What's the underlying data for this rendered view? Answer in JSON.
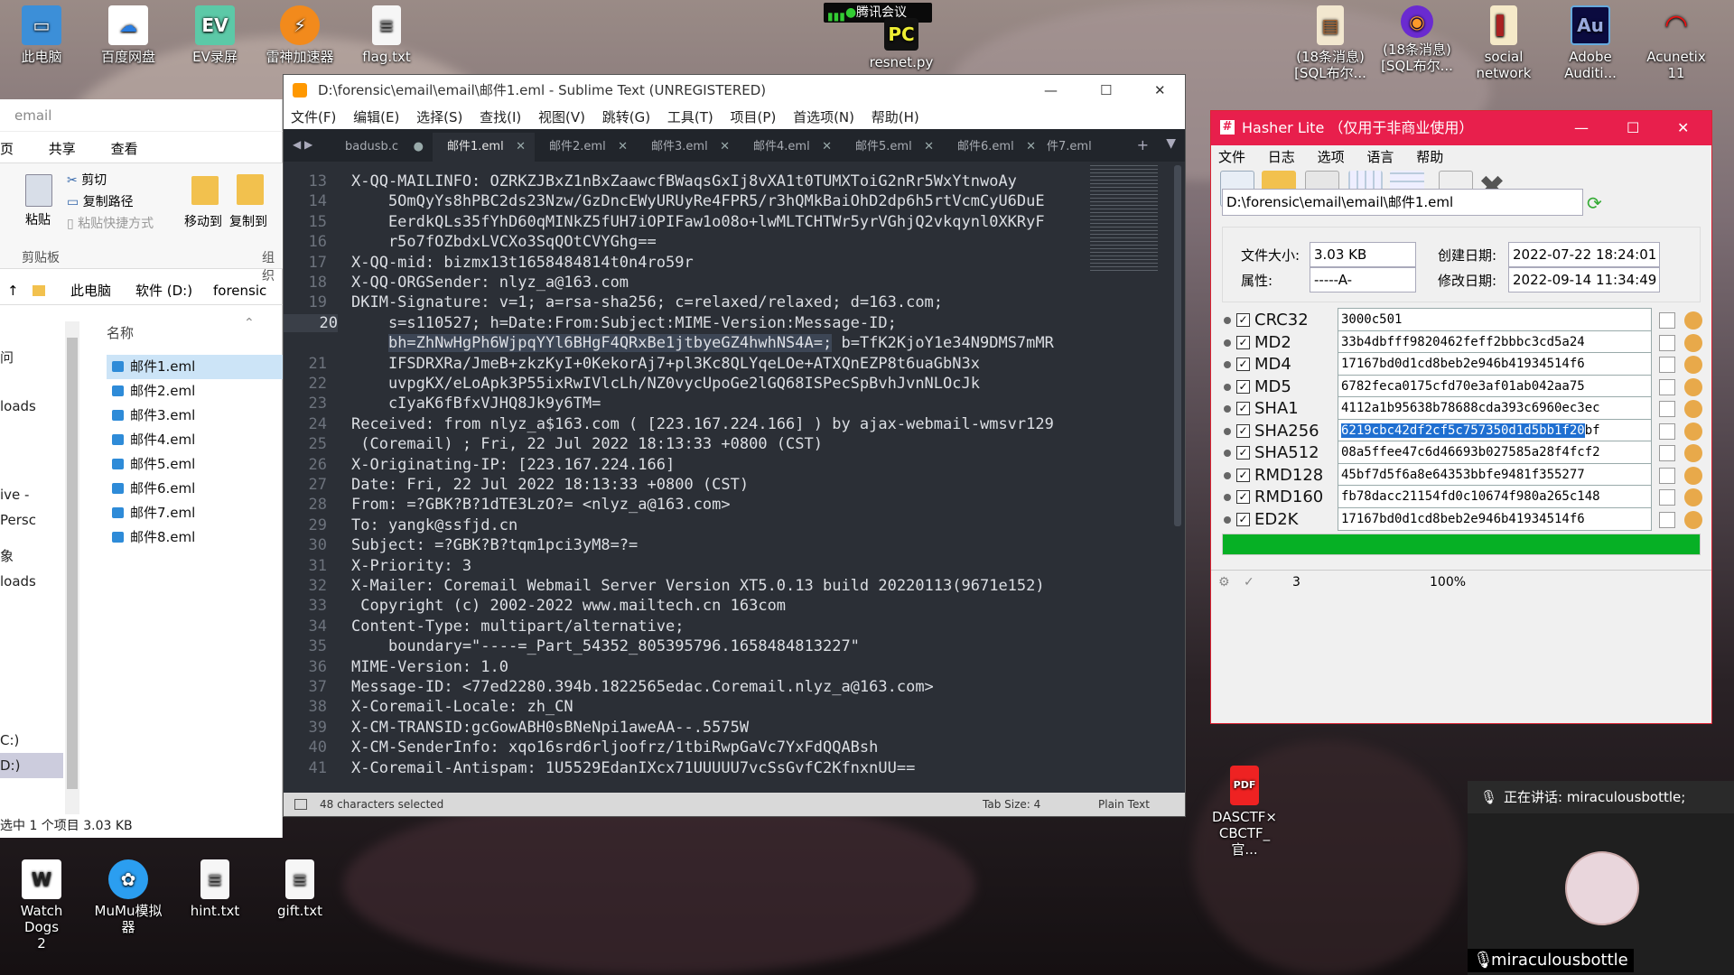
{
  "desktop_icons": [
    {
      "label": "此电脑",
      "icon": "computer-icon"
    },
    {
      "label": "百度网盘",
      "icon": "baidu-netdisk-icon"
    },
    {
      "label": "EV录屏",
      "icon": "ev-recorder-icon"
    },
    {
      "label": "雷神加速器",
      "icon": "leishen-icon"
    },
    {
      "label": "flag.txt",
      "icon": "text-file-icon"
    },
    {
      "label": "resnet.py",
      "icon": "python-file-icon"
    },
    {
      "label": "(18条消息)\n[SQL布尔...",
      "icon": "html-file-icon"
    },
    {
      "label": "(18条消息)\n[SQL布尔...",
      "icon": "firefox-icon"
    },
    {
      "label": "social\nnetwork",
      "icon": "book-icon"
    },
    {
      "label": "Adobe\nAuditi...",
      "icon": "adobe-audition-icon"
    },
    {
      "label": "Acunetix 11",
      "icon": "acunetix-icon"
    },
    {
      "label": "Watch Dogs\n2",
      "icon": "watchdogs-icon"
    },
    {
      "label": "MuMu模拟\n器",
      "icon": "mumu-icon"
    },
    {
      "label": "hint.txt",
      "icon": "text-file-icon"
    },
    {
      "label": "gift.txt",
      "icon": "text-file-icon"
    },
    {
      "label": "DASCTF×\nCBCTF_官...",
      "icon": "pdf-icon"
    }
  ],
  "tencent_meeting": {
    "label": "腾讯会议"
  },
  "explorer": {
    "address_fragment": "email",
    "ribbon_tabs": [
      "页",
      "共享",
      "查看"
    ],
    "cut": "剪切",
    "copy_path": "复制路径",
    "paste": "粘贴",
    "paste_shortcut": "粘贴快捷方式",
    "clipboard": "剪贴板",
    "move_to": "移动到",
    "copy_to": "复制到",
    "organize": "组织",
    "breadcrumb": [
      "此电脑",
      "软件 (D:)",
      "forensic"
    ],
    "column_name": "名称",
    "side_items": [
      "问",
      "loads",
      "loads",
      "ive - Persc",
      "象",
      "loads",
      "C:)",
      "D:)"
    ],
    "files": [
      "邮件1.eml",
      "邮件2.eml",
      "邮件3.eml",
      "邮件4.eml",
      "邮件5.eml",
      "邮件6.eml",
      "邮件7.eml",
      "邮件8.eml"
    ],
    "status": "选中 1 个项目  3.03 KB"
  },
  "sublime": {
    "title": "D:\\forensic\\email\\email\\邮件1.eml - Sublime Text (UNREGISTERED)",
    "menu": [
      "文件(F)",
      "编辑(E)",
      "选择(S)",
      "查找(I)",
      "视图(V)",
      "跳转(G)",
      "工具(T)",
      "项目(P)",
      "首选项(N)",
      "帮助(H)"
    ],
    "tabs": [
      "badusb.c",
      "邮件1.eml",
      "邮件2.eml",
      "邮件3.eml",
      "邮件4.eml",
      "邮件5.eml",
      "邮件6.eml",
      "件7.eml"
    ],
    "lines": [
      {
        "n": "13",
        "t": "X-QQ-MAILINFO: OZRKZJBxZ1nBxZaawcfBWaqsGxIj8vXA1t0TUMXToiG2nRr5WxYtnwoAy"
      },
      {
        "n": "14",
        "t": "    5OmQyYs8hPBC2ds23Nzw/GzDncEWyURUyRe4FPR5/r3hQMkBaiOhD2dp6h5rtVcmCyU6DuE"
      },
      {
        "n": "15",
        "t": "    EerdkQLs35fYhD60qMINkZ5fUH7iOPIFaw1o08o+lwMLTCHTWr5yrVGhjQ2vkqynl0XKRyF"
      },
      {
        "n": "16",
        "t": "    r5o7fOZbdxLVCXo3SqQOtCVYGhg=="
      },
      {
        "n": "17",
        "t": "X-QQ-mid: bizmx13t1658484814t0n4ro59r"
      },
      {
        "n": "18",
        "t": "X-QQ-ORGSender: nlyz_a@163.com"
      },
      {
        "n": "19",
        "t": "DKIM-Signature: v=1; a=rsa-sha256; c=relaxed/relaxed; d=163.com;"
      },
      {
        "n": "20",
        "t": "    s=s110527; h=Date:From:Subject:MIME-Version:Message-ID;"
      },
      {
        "n": "",
        "t": "    bh=ZhNwHgPh6WjpqYYl6BHgF4QRxBe1jtbyeGZ4hwhNS4A=; b=TfK2KjoY1e34N9DMS7mMR"
      },
      {
        "n": "21",
        "t": "    IFSDRXRa/JmeB+zkzKyI+0KekorAj7+pl3Kc8QLYqeLOe+ATXQnEZP8t6uaGbN3x"
      },
      {
        "n": "22",
        "t": "    uvpgKX/eLoApk3P55ixRwIVlcLh/NZ0vycUpoGe2lGQ68ISPecSpBvhJvnNLOcJk"
      },
      {
        "n": "23",
        "t": "    cIyaK6fBfxVJHQ8Jk9y6TM="
      },
      {
        "n": "24",
        "t": "Received: from nlyz_a$163.com ( [223.167.224.166] ) by ajax-webmail-wmsvr129"
      },
      {
        "n": "25",
        "t": " (Coremail) ; Fri, 22 Jul 2022 18:13:33 +0800 (CST)"
      },
      {
        "n": "26",
        "t": "X-Originating-IP: [223.167.224.166]"
      },
      {
        "n": "27",
        "t": "Date: Fri, 22 Jul 2022 18:13:33 +0800 (CST)"
      },
      {
        "n": "28",
        "t": "From: =?GBK?B?1dTE3LzO?= <nlyz_a@163.com>"
      },
      {
        "n": "29",
        "t": "To: yangk@ssfjd.cn"
      },
      {
        "n": "30",
        "t": "Subject: =?GBK?B?tqm1pci3yM8=?="
      },
      {
        "n": "31",
        "t": "X-Priority: 3"
      },
      {
        "n": "32",
        "t": "X-Mailer: Coremail Webmail Server Version XT5.0.13 build 20220113(9671e152)"
      },
      {
        "n": "33",
        "t": " Copyright (c) 2002-2022 www.mailtech.cn 163com"
      },
      {
        "n": "34",
        "t": "Content-Type: multipart/alternative;"
      },
      {
        "n": "35",
        "t": "    boundary=\"----=_Part_54352_805395796.1658484813227\""
      },
      {
        "n": "36",
        "t": "MIME-Version: 1.0"
      },
      {
        "n": "37",
        "t": "Message-ID: <77ed2280.394b.1822565edac.Coremail.nlyz_a@163.com>"
      },
      {
        "n": "38",
        "t": "X-Coremail-Locale: zh_CN"
      },
      {
        "n": "39",
        "t": "X-CM-TRANSID:gcGowABH0sBNeNpi1aweAA--.5575W"
      },
      {
        "n": "40",
        "t": "X-CM-SenderInfo: xqo16srd6rljoofrz/1tbiRwpGaVc7YxFdQQABsh"
      },
      {
        "n": "41",
        "t": "X-Coremail-Antispam: 1U5529EdanIXcx71UUUUU7vcSsGvfC2KfnxnUU=="
      },
      {
        "n": "42",
        "t": ""
      }
    ],
    "selected_text": "bh=ZhNwHgPh6WjpqYYl6BHgF4QRxBe1jtbyeGZ4hwhNS4A=;",
    "status_left": "48 characters selected",
    "tab_size": "Tab Size: 4",
    "syntax": "Plain Text"
  },
  "hasher": {
    "title": "Hasher Lite  （仅用于非商业使用）",
    "menu": [
      "文件",
      "日志",
      "选项",
      "语言",
      "帮助"
    ],
    "path": "D:\\forensic\\email\\email\\邮件1.eml",
    "file_size_label": "文件大小:",
    "file_size": "3.03 KB",
    "attr_label": "属性:",
    "attr": "-----A-",
    "created_label": "创建日期:",
    "created": "2022-07-22 18:24:01",
    "modified_label": "修改日期:",
    "modified": "2022-09-14 11:34:49",
    "hashes": [
      {
        "name": "CRC32",
        "value": "3000c501"
      },
      {
        "name": "MD2",
        "value": "33b4dbfff9820462feff2bbbc3cd5a24"
      },
      {
        "name": "MD4",
        "value": "17167bd0d1cd8beb2e946b41934514f6"
      },
      {
        "name": "MD5",
        "value": "6782feca0175cfd70e3af01ab042aa75"
      },
      {
        "name": "SHA1",
        "value": "4112a1b95638b78688cda393c6960ec3ec"
      },
      {
        "name": "SHA256",
        "value": "6219cbc42df2cf5c757350d1d5bb1f20bf"
      },
      {
        "name": "SHA512",
        "value": "08a5ffee47c6d46693b027585a28f4fcf2"
      },
      {
        "name": "RMD128",
        "value": "45bf7d5f6a8e64353bbfe9481f355277"
      },
      {
        "name": "RMD160",
        "value": "fb78dacc21154fd0c10674f980a265c148"
      },
      {
        "name": "ED2K",
        "value": "17167bd0d1cd8beb2e946b41934514f6"
      }
    ],
    "progress": 1.0,
    "status_count": "3",
    "status_percent": "100%"
  },
  "meeting_panel": {
    "speaking": "正在讲话: miraculousbottle;",
    "user": "miraculousbottle"
  }
}
